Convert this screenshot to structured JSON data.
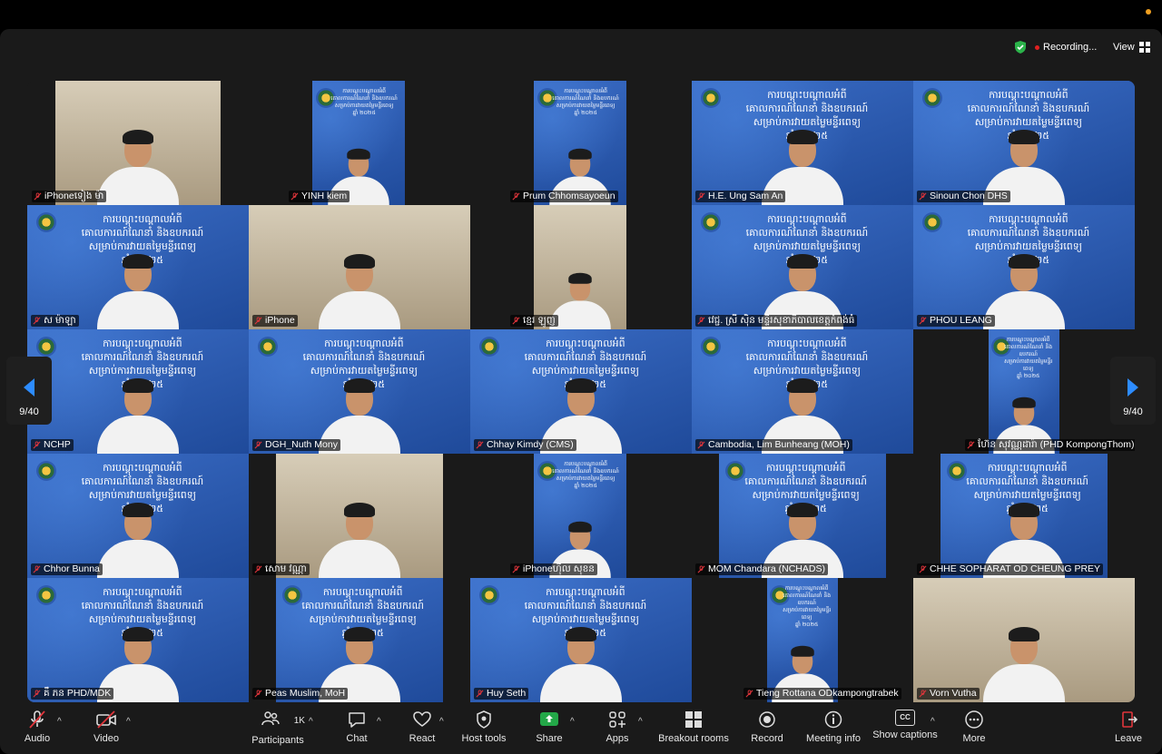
{
  "top": {
    "recording": "Recording...",
    "view": "View"
  },
  "pager": {
    "left": "9/40",
    "right": "9/40"
  },
  "slide_text": [
    "ការបណ្តុះបណ្តាលអំពី",
    "គោលការណ៍ណែនាំ និងឧបករណ៍",
    "សម្រាប់ការវាយតម្លៃមន្ទីរពេទ្យ",
    "ឆ្នាំ ២០២៥"
  ],
  "participants": [
    {
      "name": "iPhoneទៀង ម៉ា",
      "kind": "photo"
    },
    {
      "name": "YINH kiem",
      "kind": "slide"
    },
    {
      "name": "Prum Chhomsayoeun",
      "kind": "slide"
    },
    {
      "name": "H.E. Ung Sam An",
      "kind": "slide"
    },
    {
      "name": "Sinoun Chon DHS",
      "kind": "slide"
    },
    {
      "name": "ស ម៉ាឡា",
      "kind": "slide"
    },
    {
      "name": "iPhone",
      "kind": "photo"
    },
    {
      "name": "ខ្មេរ ឡូញ",
      "kind": "photo"
    },
    {
      "name": "វេជ្ជ. ស្រី ស៊ិន មន្ទីរសុខាភិបាលខេត្តកំពង់ធំ",
      "kind": "slide"
    },
    {
      "name": "PHOU LEANG",
      "kind": "slide"
    },
    {
      "name": "NCHP",
      "kind": "slide"
    },
    {
      "name": "DGH_Nuth Mony",
      "kind": "slide"
    },
    {
      "name": "Chhay Kimdy (CMS)",
      "kind": "slide"
    },
    {
      "name": "Cambodia, Lim Bunheang (MOH)",
      "kind": "slide"
    },
    {
      "name": "ហ៊ែន សុវណ្ណដារ៉ា (PHD KompongThom)",
      "kind": "slide"
    },
    {
      "name": "Chhor Bunna",
      "kind": "slide"
    },
    {
      "name": "សោម វណ្ណា",
      "kind": "photo"
    },
    {
      "name": "iPhoneហ៊ីល សុខន",
      "kind": "slide"
    },
    {
      "name": "MOM Chandara (NCHADS)",
      "kind": "slide"
    },
    {
      "name": "CHHE SOPHARAT OD CHEUNG PREY",
      "kind": "slide"
    },
    {
      "name": "គឹ ភន PHD/MDK",
      "kind": "slide"
    },
    {
      "name": "Peas Muslim, MoH",
      "kind": "slide"
    },
    {
      "name": "Huy Seth",
      "kind": "slide"
    },
    {
      "name": "Tieng Rottana ODkampongtrabek",
      "kind": "slide"
    },
    {
      "name": "Vorn Vutha",
      "kind": "photo"
    }
  ],
  "toolbar": {
    "audio": "Audio",
    "video": "Video",
    "participants": "Participants",
    "participants_count": "1K",
    "chat": "Chat",
    "react": "React",
    "host_tools": "Host tools",
    "share": "Share",
    "apps": "Apps",
    "breakout": "Breakout rooms",
    "record": "Record",
    "meeting_info": "Meeting info",
    "captions": "Show captions",
    "captions_badge": "CC",
    "more": "More",
    "leave": "Leave"
  }
}
